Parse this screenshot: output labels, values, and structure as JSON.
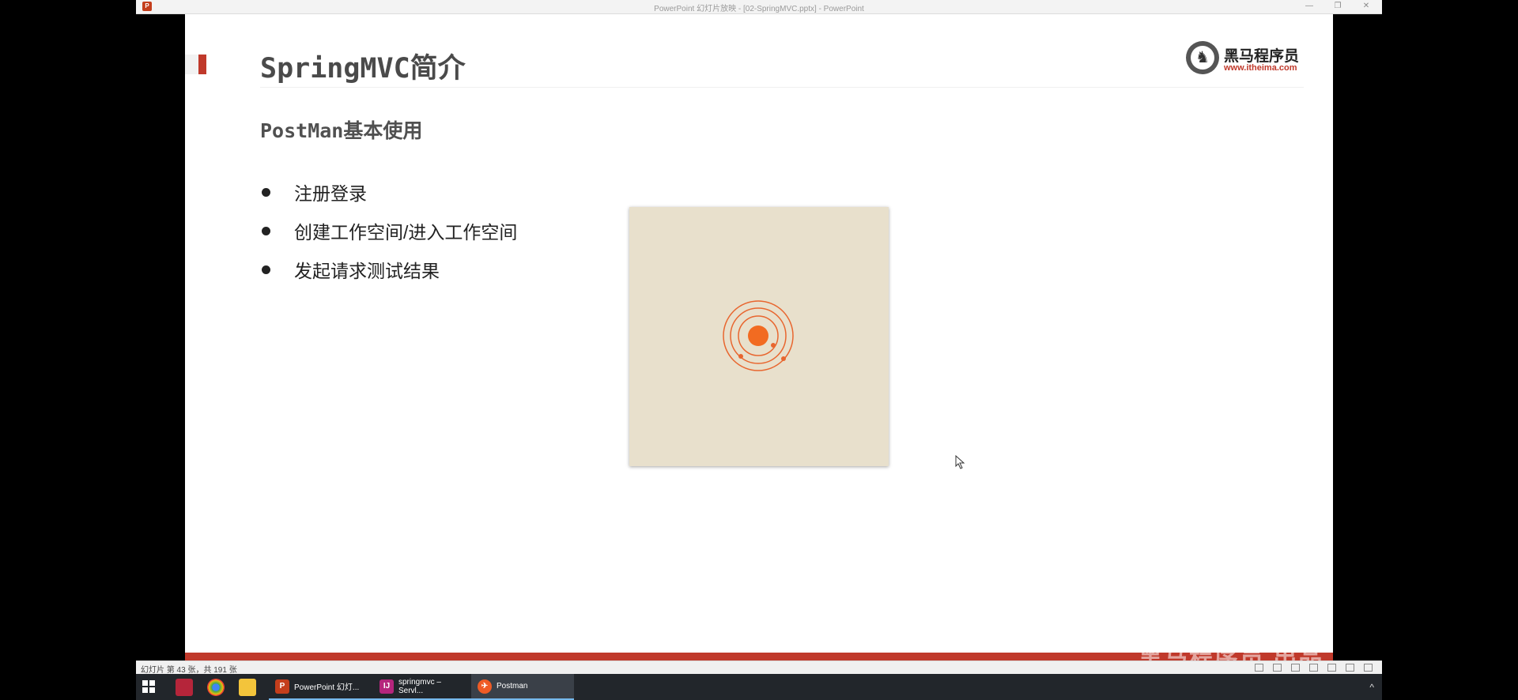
{
  "window": {
    "title": "PowerPoint 幻灯片放映 - [02-SpringMVC.pptx] - PowerPoint",
    "app_icon_label": "P",
    "controls": [
      "—",
      "❐",
      "✕"
    ]
  },
  "slide": {
    "title": "SpringMVC简介",
    "subtitle": "PostMan基本使用",
    "bullets": [
      "注册登录",
      "创建工作空间/进入工作空间",
      "发起请求测试结果"
    ],
    "logo": {
      "name": "黑马程序员",
      "url": "www.itheima.com"
    },
    "accent_color": "#c0392b",
    "loading_image": {
      "background": "#e8e0cc",
      "orbit_color": "#e8662f"
    },
    "watermark": "黑马程序员  出品"
  },
  "status_bar": {
    "slide_count": "幻灯片 第 43 张，共 191 张"
  },
  "taskbar": {
    "apps": [
      {
        "label": "PowerPoint 幻灯...",
        "icon": "powerpoint-icon",
        "color": "#c43e1c",
        "glyph": "P"
      },
      {
        "label": "springmvc – Servl...",
        "icon": "intellij-icon",
        "color": "#b5257c",
        "glyph": "IJ"
      },
      {
        "label": "Postman",
        "icon": "postman-icon",
        "color": "#ef5b25",
        "glyph": "✈"
      }
    ],
    "tray_arrow": "^"
  }
}
